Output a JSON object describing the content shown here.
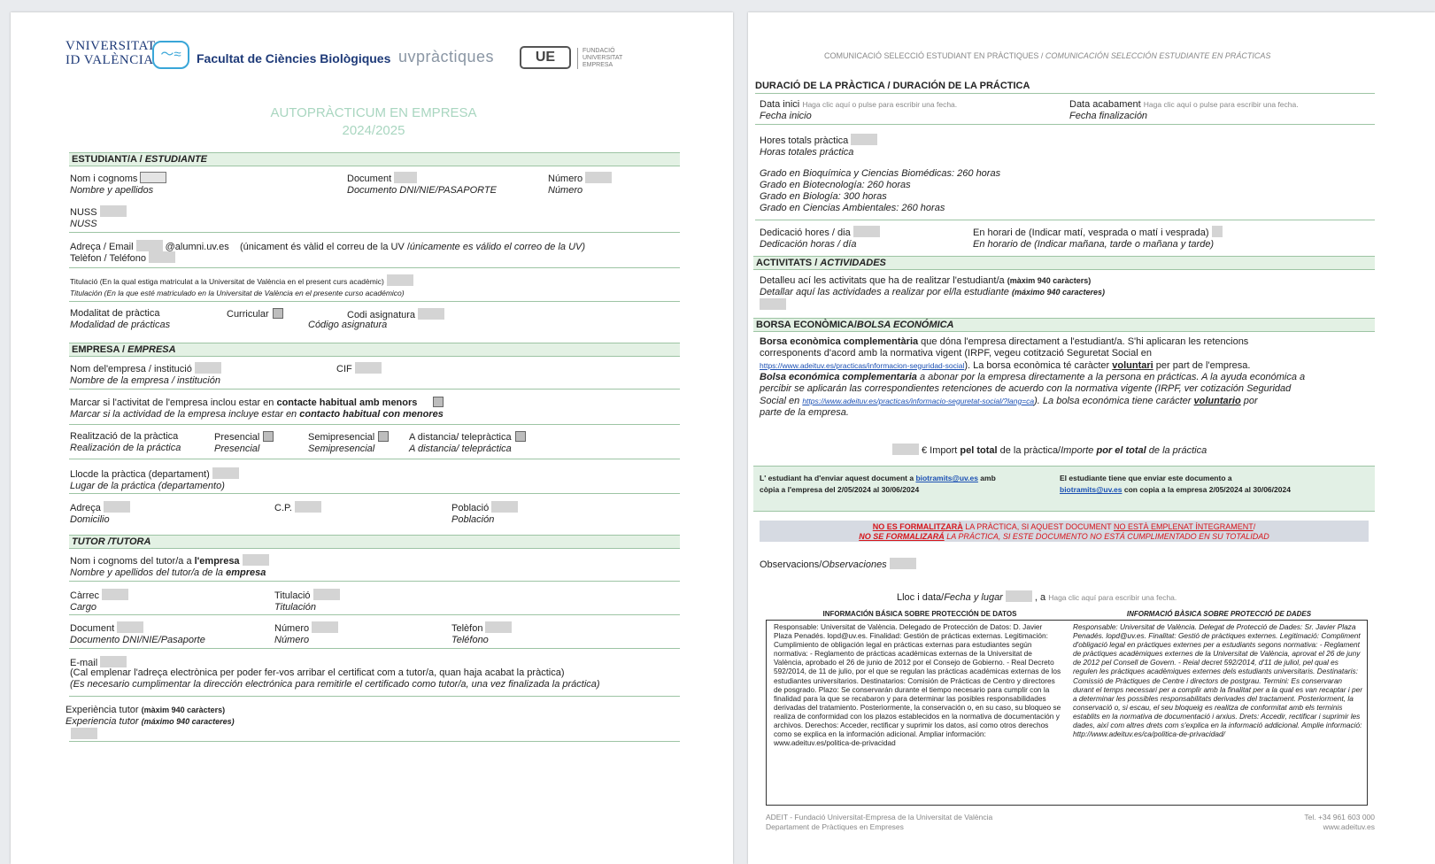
{
  "p1": {
    "logos": {
      "uv_line1": "VNIVERSITAT",
      "uv_line2": "ID VALÈNCIA",
      "faculty": "Facultat de Ciències Biològiques",
      "practiques": "uvpràctiques",
      "ue": "UE",
      "adeit": "FUNDACIÓ UNIVERSITAT EMPRESA"
    },
    "title": "AUTOPRÀCTICUM EN EMPRESA",
    "year": "2024/2025",
    "student": {
      "head_ca": "ESTUDIANT/A / ",
      "head_es": "ESTUDIANTE",
      "name_ca": "Nom i cognoms",
      "name_es": "Nombre y apellidos",
      "doc_ca": "Document",
      "doc_es": "Documento DNI/NIE/PASAPORTE",
      "num_ca": "Número",
      "num_es": "Número",
      "nuss_ca": "NUSS",
      "nuss_es": "NUSS",
      "email_ca": "Adreça / Email",
      "email_suffix": "@alumni.uv.es",
      "email_note_ca": "(únicament és vàlid el correu de la UV /",
      "email_note_es": "únicamente es válido el correo de la UV)",
      "phone": "Telèfon / Teléfono",
      "degree_ca": "Titulació (En la qual estiga matriculat a la Universitat de València en el present curs acadèmic)",
      "degree_es": "Titulación (En la que esté matriculado en la Universitat de València en el presente curso académico)",
      "mode_ca": "Modalitat de pràctica",
      "mode_es": "Modalidad de prácticas",
      "curricular": "Curricular",
      "code_ca": "Codi asignatura",
      "code_es": "Código asignatura"
    },
    "company": {
      "head_ca": "EMPRESA / ",
      "head_es": "EMPRESA",
      "name_ca": "Nom del'empresa / institució",
      "name_es": "Nombre de la  empresa / institución",
      "cif": "CIF",
      "minors_ca_pre": "Marcar si l'activitat de l'empresa inclou estar en ",
      "minors_ca_bold": "contacte habitual amb menors",
      "minors_es_pre": "Marcar si la actividad de la empresa incluye estar en ",
      "minors_es_bold": "contacto habitual con menores",
      "real_ca": "Realització de la pràctica",
      "real_es": "Realización de la práctica",
      "pres_ca": "Presencial",
      "pres_es": "Presencial",
      "semi_ca": "Semipresencial",
      "semi_es": "Semipresencial",
      "dist_ca": "A distancia/ telepràctica",
      "dist_es": "A distancia/ telepráctica",
      "place_ca": "Llocde la pràctica (departament)",
      "place_es": "Lugar de la práctica (departamento)",
      "addr_ca": "Adreça",
      "addr_es": "Domicilio",
      "cp": "C.P.",
      "town_ca": "Població",
      "town_es": "Población"
    },
    "tutor": {
      "head_ca": "TUTOR /",
      "head_es": "TUTORA",
      "name_ca_pre": "Nom i cognoms del tutor/a a ",
      "name_ca_bold": "l'empresa",
      "name_es_pre": "Nombre y apellidos del tutor/a de la ",
      "name_es_bold": "empresa",
      "pos_ca": "Càrrec",
      "pos_es": "Cargo",
      "tit_ca": "Titulació",
      "tit_es": "Titulación",
      "doc_ca": "Document",
      "doc_es": "Documento DNI/NIE/Pasaporte",
      "num_ca": "Número",
      "num_es": "Número",
      "tel_ca": "Telèfon",
      "tel_es": "Teléfono",
      "email": "E-mail",
      "email_note_ca": "(Cal emplenar l'adreça electrònica per poder fer-vos arribar el certificat com a tutor/a, quan haja acabat la pràctica)",
      "email_note_es": "(Es necesario cumplimentar la dirección electrónica para remitirle el certificado como tutor/a, una vez finalizada la práctica)",
      "exp_ca": "Experiència tutor",
      "exp_ca_note": "(màxim 940 caràcters)",
      "exp_es": "Experiencia tutor",
      "exp_es_note": "(máximo 940 caracteres)"
    }
  },
  "p2": {
    "header_ca": "COMUNICACIÓ SELECCIÓ ESTUDIANT EN PRÀCTIQUES / ",
    "header_es": "COMUNICACIÓN SELECCIÓN ESTUDIANTE EN PRÁCTICAS",
    "duration": {
      "head": "DURACIÓ DE LA PRÀCTICA / DURACIÓN DE LA PRÁCTICA",
      "start_ca": "Data inici",
      "start_es": "Fecha inicio",
      "end_ca": "Data acabament",
      "end_es": "Fecha finalización",
      "date_hint": "Haga clic aquí o pulse para escribir una fecha.",
      "total_ca": "Hores totals pràctica",
      "total_es": "Horas totales práctica",
      "grades": [
        "Grado en Bioquímica y Ciencias Biomédicas: 260 horas",
        "Grado en Biotecnología: 260 horas",
        "Grado en Biología: 300 horas",
        "Grado en Ciencias Ambientales: 260 horas"
      ],
      "daily_ca": "Dedicació hores / dia",
      "daily_es": "Dedicación horas / día",
      "sched_ca": "En horari de (Indicar matí, vesprada o matí i vesprada)",
      "sched_es": "En horario de (Indicar mañana, tarde o mañana y tarde)"
    },
    "activities": {
      "head_ca": "ACTIVITATS / ",
      "head_es": "ACTIVIDADES",
      "detail_ca": "Detalleu ací les activitats que ha de realitzar l'estudiant/a",
      "detail_ca_note": "(màxim 940 caràcters)",
      "detail_es": "Detallar aquí las actividades a realizar por el/la estudiante",
      "detail_es_note": "(máximo 940 caracteres)"
    },
    "grant": {
      "head_ca": "BORSA ECONÒMICA/",
      "head_es": "BOLSA ECONÓMICA",
      "ca_bold": "Borsa econòmica complementària",
      "ca_line1": " que dóna l'empresa directament a l'estudiant/a. S'hi aplicaran les retencions",
      "ca_line2": "corresponents d'acord amb la normativa vigent (IRPF, vegeu cotització Seguretat Social en",
      "ca_link": "https://www.adeituv.es/practicas/informacion-seguridad-social",
      "ca_line3": "). La borsa econòmica té caràcter ",
      "ca_vol": "voluntari",
      "ca_line3b": " per part de l'empresa.",
      "es_bold": "Bolsa económica complementaria",
      "es_line1": " a abonar por la empresa directamente a la persona en prácticas. A la ayuda económica a",
      "es_line2": "percibir se aplicarán las correspondientes retenciones de acuerdo con la normativa vigente (IRPF, ver cotización Seguridad",
      "es_line3": "Social en ",
      "es_link": "https://www.adeituv.es/practicas/informacio-seguretat-social/?lang=ca",
      "es_line3b": "). La bolsa económica tiene carácter ",
      "es_vol": "voluntario",
      "es_line3c": " por",
      "es_line4": "parte de la empresa.",
      "import_ca": "€ Import ",
      "import_ca_b": "pel total",
      "import_ca2": " de la pràctica/",
      "import_es": "Importe ",
      "import_es_b": "por el total",
      "import_es2": " de la práctica"
    },
    "send": {
      "ca1": "L' estudiant ha d'enviar aquest document a ",
      "ca_mail": "biotramits@uv.es",
      "ca2": " amb",
      "ca3": "còpia a l'empresa del 2/05/2024 al 30/06/2024",
      "es1": "El estudiante tiene que enviar este documento a",
      "es_mail": "biotramits@uv.es",
      "es2": "  con copia a la empresa 2/05/2024 al 30/06/2024"
    },
    "warning": {
      "ca_u1": "NO ES FORMALITZARÀ",
      "ca_mid": " LA PRÀCTICA, SI AQUEST DOCUMENT ",
      "ca_u2": "NO ESTÀ EMPLENAT ÍNTEGRAMENT",
      "ca_end": "/",
      "es_u1": "NO SE FORMALIZARÁ",
      "es_rest": " LA PRÁCTICA, SI ESTE DOCUMENTO NO ESTÁ CUMPLIMENTADO EN SU TOTALIDAD"
    },
    "obs_ca": "Observacions/",
    "obs_es": "Observaciones",
    "place_ca": "Lloc i data/",
    "place_es": "Fecha y lugar",
    "place_a": ", a",
    "place_hint": "Haga clic aquí para escribir una fecha.",
    "info": {
      "head_es": "INFORMACIÓN BÁSICA SOBRE PROTECCIÓN DE DATOS",
      "head_ca": "INFORMACIÓ BÀSICA SOBRE PROTECCIÓ DE DADES",
      "es_text": "Responsable: Universitat de València. Delegado de Protección de Datos: D. Javier Plaza Penadés. lopd@uv.es. Finalidad: Gestión de prácticas externas. Legitimación: Cumplimiento de obligación legal en prácticas externas para estudiantes según normativa: - Reglamento de prácticas académicas externas de la Universitat de València, aprobado el 26 de junio de 2012 por el Consejo de Gobierno. - Real Decreto 592/2014, de 11 de julio, por el que se regulan las prácticas académicas externas de los estudiantes universitarios. Destinatarios: Comisión de Prácticas de Centro y directores de posgrado. Plazo: Se conservarán durante el tiempo necesario para cumplir con la finalidad para la que se recabaron y para determinar las posibles responsabilidades derivadas del tratamiento. Posteriormente, la conservación o, en su caso, su bloqueo se realiza de conformidad con los plazos establecidos en la normativa de documentación y archivos. Derechos: Acceder, rectificar y suprimir los datos, así como otros derechos como se explica en la información adicional. Ampliar información: www.adeituv.es/politica-de-privacidad",
      "ca_text": "Responsable: Universitat de València. Delegat de Protecció de Dades: Sr. Javier Plaza Penadés. lopd@uv.es. Finalitat: Gestió de pràctiques externes. Legitimació: Compliment d'obligació legal en pràctiques externes per a estudiants segons normativa: - Reglament de pràctiques acadèmiques externes de la Universitat de València, aprovat el 26 de juny de 2012 pel Consell de Govern. - Reial decret 592/2014, d'11 de juliol, pel qual es regulen les pràctiques acadèmiques externes dels estudiants universitaris. Destinataris: Comissió de Pràctiques de Centre i directors de postgrau. Termini: Es conservaran durant el temps necessari per a complir amb la finalitat per a la qual es van recaptar i per a determinar les possibles responsabilitats derivades del tractament. Posteriorment, la conservació o, si escau, el seu bloqueig es realitza de conformitat amb els terminis establits en la normativa de documentació i arxius. Drets: Accedir, rectificar i suprimir les dades, així com altres drets com s'explica en la informació addicional. Amplie informació: http://www.adeituv.es/ca/politica-de-privacidad/"
    },
    "footer_l1": "ADEIT - Fundació Universitat-Empresa de la Universitat de València",
    "footer_l2": "Departament de Pràctiques en Empreses",
    "footer_r1": "Tel. +34 961 603 000",
    "footer_r2": "www.adeituv.es"
  },
  "colors": {
    "section_bg": "#e3f1e4",
    "section_line": "#9dc4a4",
    "title": "#a9d6c0",
    "warning": "#d6151b",
    "warning_bg": "#d6dae2",
    "send_bg": "#e2f0e5"
  }
}
